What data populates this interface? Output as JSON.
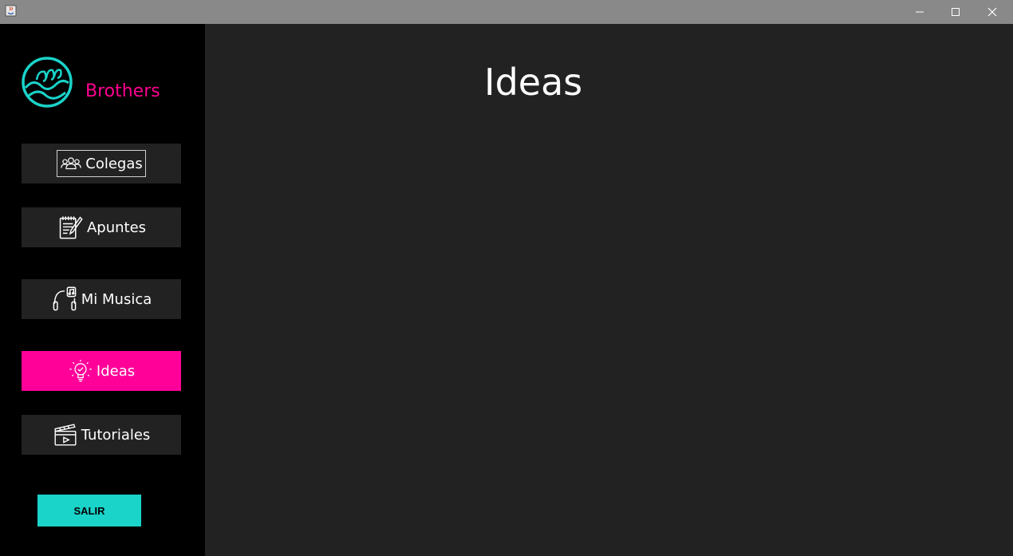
{
  "window": {
    "controls": {
      "minimize": "—",
      "maximize": "☐",
      "close": "✕"
    }
  },
  "brand": {
    "name": "Brothers",
    "color": "#ff0090",
    "logo_icon": "wave-logo-icon"
  },
  "nav": {
    "items": [
      {
        "label": "Colegas",
        "icon": "group-icon",
        "active": false
      },
      {
        "label": "Apuntes",
        "icon": "notepad-pencil-icon",
        "active": false
      },
      {
        "label": "Mi Musica",
        "icon": "headphones-music-icon",
        "active": false
      },
      {
        "label": "Ideas",
        "icon": "lightbulb-check-icon",
        "active": true
      },
      {
        "label": "Tutoriales",
        "icon": "clapperboard-icon",
        "active": false
      }
    ]
  },
  "exit_button": {
    "label": "SALIR"
  },
  "main": {
    "title": "Ideas"
  },
  "colors": {
    "sidebar": "#000000",
    "content": "#222222",
    "active": "#ff0099",
    "exit": "#1ad3c9",
    "titlebar": "#898989"
  }
}
